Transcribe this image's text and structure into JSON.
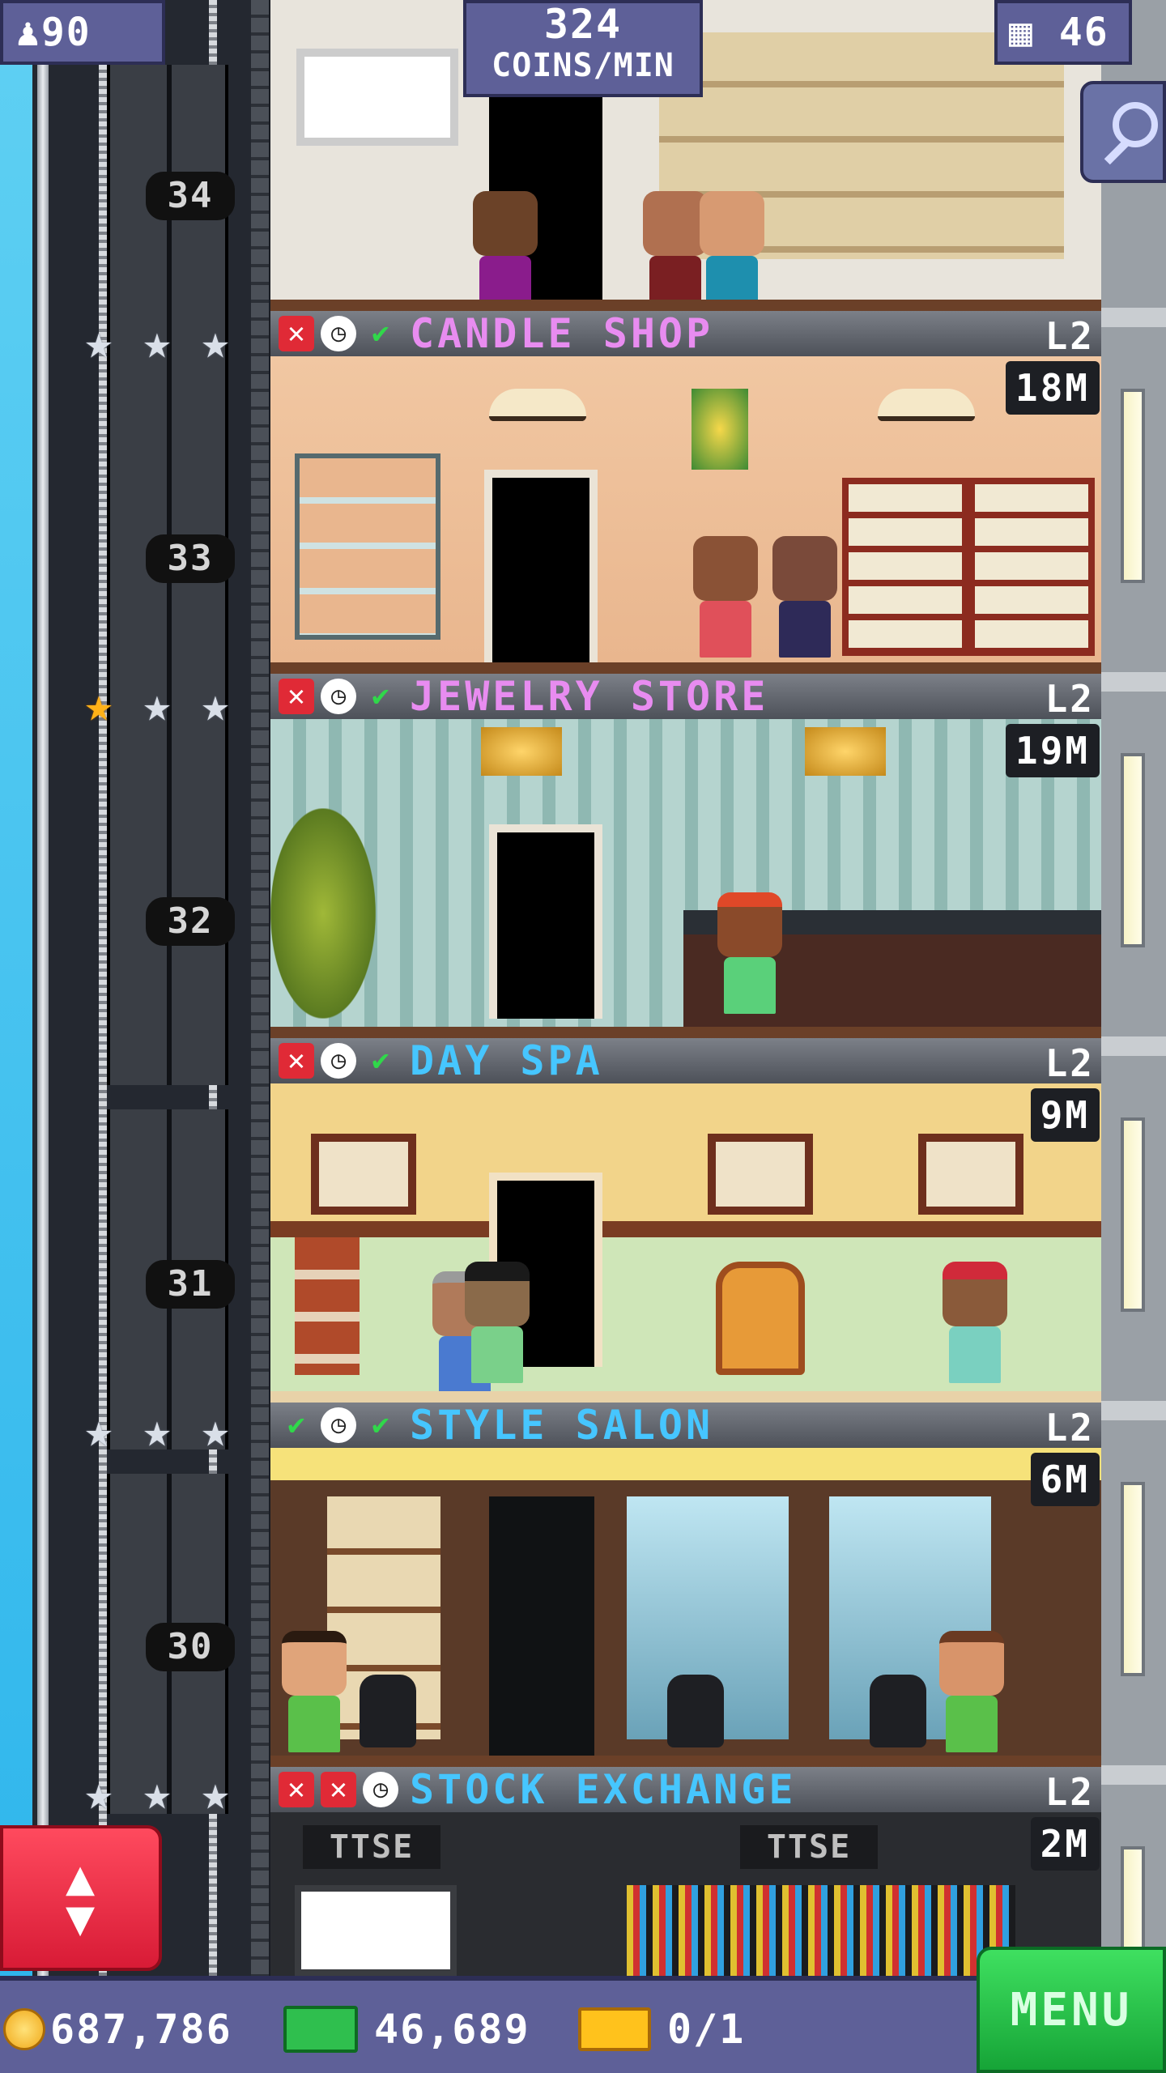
{
  "hud": {
    "population": "90",
    "coins_per_min_value": "324",
    "coins_per_min_label": "COINS/MIN",
    "floor_count": "46"
  },
  "elevator": {
    "floor_numbers": [
      "34",
      "33",
      "32",
      "31",
      "30"
    ]
  },
  "floors": [
    {
      "name": "CANDLE SHOP",
      "level": "L2",
      "price": "18M",
      "name_color": "#e88cf0",
      "status": [
        "x",
        "clock",
        "check"
      ],
      "stars": [
        "silver",
        "silver",
        "silver"
      ]
    },
    {
      "name": "JEWELRY STORE",
      "level": "L2",
      "price": "19M",
      "name_color": "#e88cf0",
      "status": [
        "x",
        "clock",
        "check"
      ],
      "stars": [
        "gold",
        "silver",
        "silver"
      ]
    },
    {
      "name": "DAY SPA",
      "level": "L2",
      "price": "9M",
      "name_color": "#46c6ff",
      "status": [
        "x",
        "clock",
        "check"
      ],
      "stars": []
    },
    {
      "name": "STYLE SALON",
      "level": "L2",
      "price": "6M",
      "name_color": "#46c6ff",
      "status": [
        "check",
        "clock",
        "check"
      ],
      "stars": [
        "silver",
        "silver",
        "silver"
      ]
    },
    {
      "name": "STOCK EXCHANGE",
      "level": "L2",
      "price": "2M",
      "name_color": "#46c6ff",
      "status": [
        "x",
        "x",
        "clock"
      ],
      "stars": [
        "silver",
        "silver",
        "silver"
      ]
    }
  ],
  "stock_exchange": {
    "sign_left": "TTSE",
    "sign_right": "TTSE"
  },
  "bottom_bar": {
    "coins": "687,786",
    "bux": "46,689",
    "tickets": "0/1",
    "menu_label": "MENU"
  },
  "colors": {
    "hud_bg": "#5e6098",
    "menu_green": "#22c045",
    "elevator_red": "#e8253d",
    "pink_label": "#e88cf0",
    "blue_label": "#46c6ff"
  }
}
